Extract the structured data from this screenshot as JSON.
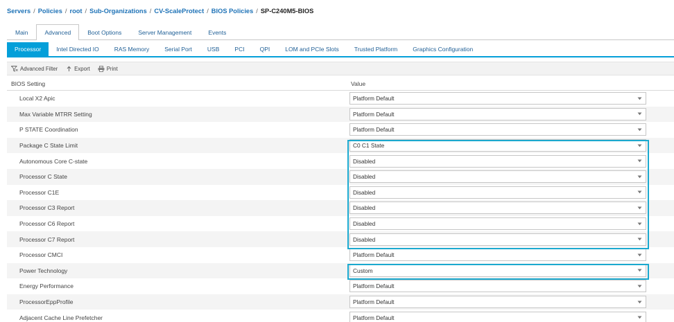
{
  "breadcrumb": {
    "items": [
      "Servers",
      "Policies",
      "root",
      "Sub-Organizations",
      "CV-ScaleProtect",
      "BIOS Policies"
    ],
    "separator": "/",
    "current": "SP-C240M5-BIOS"
  },
  "top_tabs": [
    {
      "label": "Main",
      "active": false
    },
    {
      "label": "Advanced",
      "active": true
    },
    {
      "label": "Boot Options",
      "active": false
    },
    {
      "label": "Server Management",
      "active": false
    },
    {
      "label": "Events",
      "active": false
    }
  ],
  "sub_tabs": [
    {
      "label": "Processor",
      "active": true
    },
    {
      "label": "Intel Directed IO",
      "active": false
    },
    {
      "label": "RAS Memory",
      "active": false
    },
    {
      "label": "Serial Port",
      "active": false
    },
    {
      "label": "USB",
      "active": false
    },
    {
      "label": "PCI",
      "active": false
    },
    {
      "label": "QPI",
      "active": false
    },
    {
      "label": "LOM and PCIe Slots",
      "active": false
    },
    {
      "label": "Trusted Platform",
      "active": false
    },
    {
      "label": "Graphics Configuration",
      "active": false
    }
  ],
  "toolbar": {
    "advanced_filter": "Advanced Filter",
    "export": "Export",
    "print": "Print"
  },
  "table": {
    "headers": {
      "setting": "BIOS Setting",
      "value": "Value"
    },
    "rows": [
      {
        "setting": "Local X2 Apic",
        "value": "Platform Default"
      },
      {
        "setting": "Max Variable MTRR Setting",
        "value": "Platform Default"
      },
      {
        "setting": "P STATE Coordination",
        "value": "Platform Default"
      },
      {
        "setting": "Package C State Limit",
        "value": "C0 C1 State"
      },
      {
        "setting": "Autonomous Core C-state",
        "value": "Disabled"
      },
      {
        "setting": "Processor C State",
        "value": "Disabled"
      },
      {
        "setting": "Processor C1E",
        "value": "Disabled"
      },
      {
        "setting": "Processor C3 Report",
        "value": "Disabled"
      },
      {
        "setting": "Processor C6 Report",
        "value": "Disabled"
      },
      {
        "setting": "Processor C7 Report",
        "value": "Disabled"
      },
      {
        "setting": "Processor CMCI",
        "value": "Platform Default"
      },
      {
        "setting": "Power Technology",
        "value": "Custom"
      },
      {
        "setting": "Energy Performance",
        "value": "Platform Default"
      },
      {
        "setting": "ProcessorEppProfile",
        "value": "Platform Default"
      },
      {
        "setting": "Adjacent Cache Line Prefetcher",
        "value": "Platform Default"
      }
    ]
  },
  "colors": {
    "accent": "#049fd9",
    "link": "#1f73b7",
    "highlight": "#1ba9cf"
  }
}
